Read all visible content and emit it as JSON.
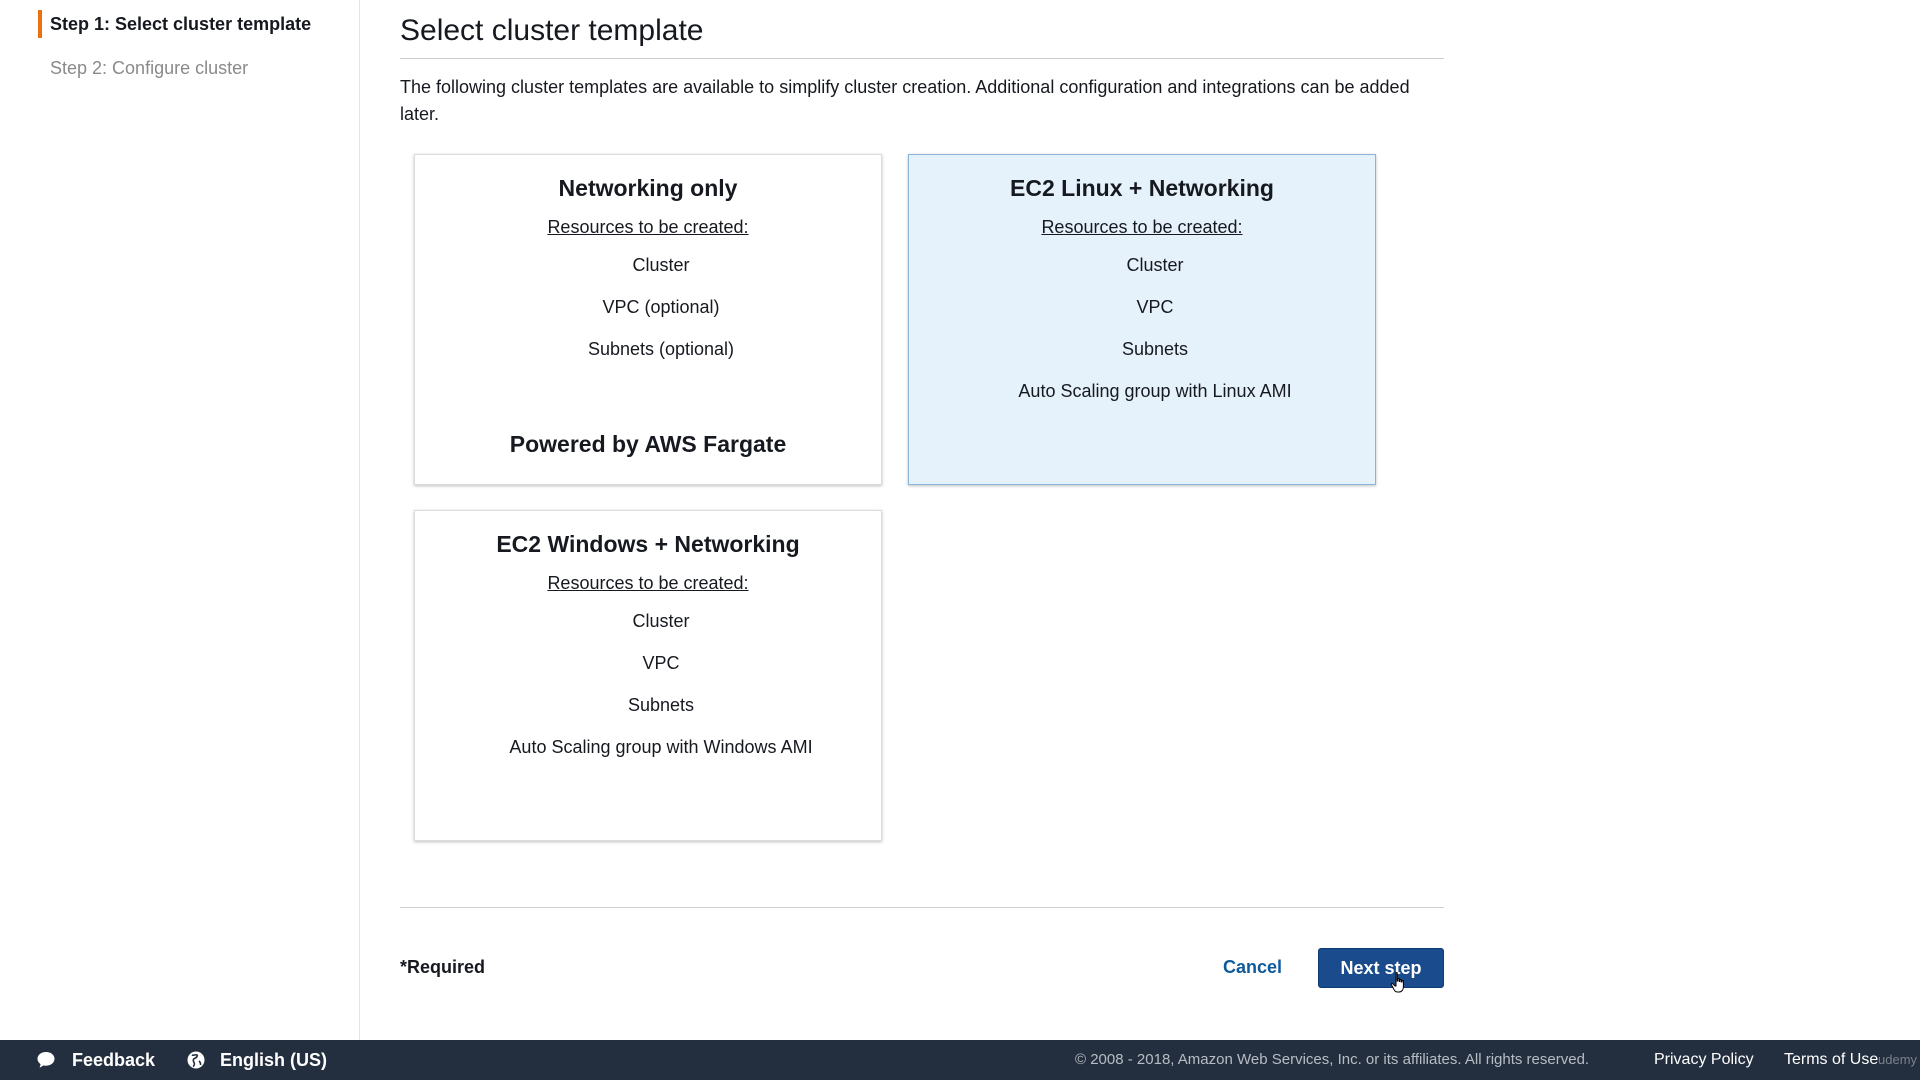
{
  "sidebar": {
    "steps": [
      {
        "label": "Step 1: Select cluster template",
        "active": true
      },
      {
        "label": "Step 2: Configure cluster",
        "active": false
      }
    ],
    "accent_color": "#ec7211"
  },
  "main": {
    "title": "Select cluster template",
    "description": "The following cluster templates are available to simplify cluster creation. Additional configuration and integrations can be added later.",
    "cards": [
      {
        "title": "Networking only",
        "subtitle": "Resources to be created:",
        "resources": [
          "Cluster",
          "VPC (optional)",
          "Subnets (optional)"
        ],
        "footer": "Powered by AWS Fargate",
        "selected": false
      },
      {
        "title": "EC2 Linux + Networking",
        "subtitle": "Resources to be created:",
        "resources": [
          "Cluster",
          "VPC",
          "Subnets",
          "Auto Scaling group with Linux AMI"
        ],
        "footer": "",
        "selected": true
      },
      {
        "title": "EC2 Windows + Networking",
        "subtitle": "Resources to be created:",
        "resources": [
          "Cluster",
          "VPC",
          "Subnets",
          "Auto Scaling group with Windows AMI"
        ],
        "footer": "",
        "selected": false
      }
    ],
    "required_label": "*Required",
    "cancel_label": "Cancel",
    "next_label": "Next step"
  },
  "footer": {
    "feedback_label": "Feedback",
    "language_label": "English (US)",
    "copyright": "© 2008 - 2018, Amazon Web Services, Inc. or its affiliates. All rights reserved.",
    "privacy_label": "Privacy Policy",
    "terms_label": "Terms of Use",
    "watermark": "udemy"
  },
  "colors": {
    "primary_button": "#1a4b8c",
    "link": "#0e5a9e",
    "selected_card": "#e6f2fb",
    "footer_bg": "#232f3e"
  }
}
